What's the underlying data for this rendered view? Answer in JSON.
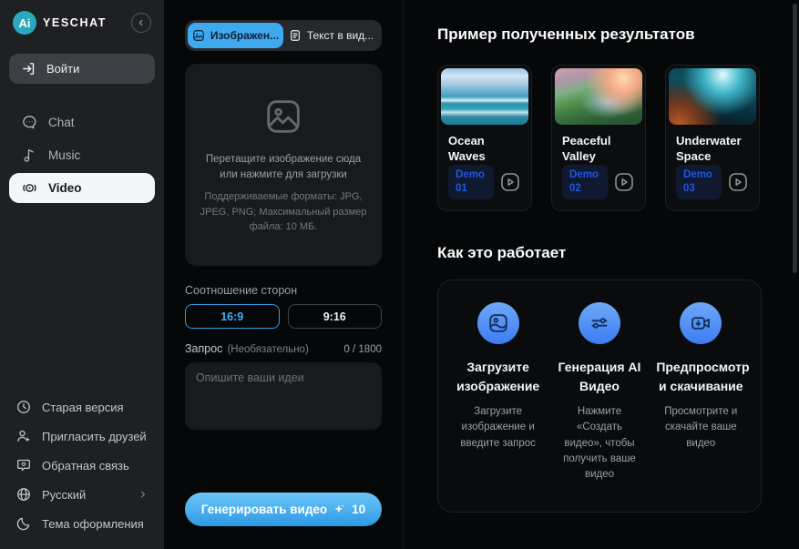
{
  "brand": {
    "name": "YESCHAT",
    "logo_text": "Ai"
  },
  "sidebar": {
    "login_label": "Войти",
    "nav": [
      {
        "label": "Chat",
        "icon": "chat-bubble-icon"
      },
      {
        "label": "Music",
        "icon": "music-note-icon"
      },
      {
        "label": "Video",
        "icon": "video-broadcast-icon",
        "active": true
      }
    ],
    "footer": [
      {
        "label": "Старая версия",
        "icon": "clock-icon"
      },
      {
        "label": "Пригласить друзей",
        "icon": "invite-user-icon"
      },
      {
        "label": "Обратная связь",
        "icon": "feedback-heart-icon"
      },
      {
        "label": "Русский",
        "icon": "globe-icon",
        "chevron": true
      },
      {
        "label": "Тема оформления",
        "icon": "moon-icon"
      }
    ]
  },
  "generator": {
    "tabs": [
      {
        "label": "Изображен...",
        "icon": "image-icon",
        "active": true
      },
      {
        "label": "Текст в вид...",
        "icon": "text-doc-icon",
        "active": false
      }
    ],
    "upload": {
      "icon": "image-placeholder-icon",
      "line1": "Перетащите изображение сюда или нажмите для загрузки",
      "line2": "Поддерживаемые форматы: JPG, JPEG, PNG; Максимальный размер файла: 10 МБ."
    },
    "aspect_label": "Соотношение сторон",
    "aspect_options": [
      {
        "label": "16:9",
        "active": true
      },
      {
        "label": "9:16",
        "active": false
      }
    ],
    "prompt": {
      "label": "Запрос",
      "optional": "(Необязательно)",
      "counter": "0 / 1800",
      "placeholder": "Опишите ваши идеи",
      "value": ""
    },
    "generate": {
      "label": "Генерировать видео",
      "icon": "sparkle-icon",
      "credits": "10"
    }
  },
  "examples": {
    "title": "Пример полученных результатов",
    "cards": [
      {
        "title": "Ocean Waves",
        "badge": "Demo 01",
        "thumbnail": "ocean-video-thumbnail"
      },
      {
        "title": "Peaceful Valley",
        "badge": "Demo 02",
        "thumbnail": "valley-video-thumbnail"
      },
      {
        "title": "Underwater Space",
        "badge": "Demo 03",
        "thumbnail": "underwater-video-thumbnail"
      }
    ]
  },
  "how": {
    "title": "Как это работает",
    "steps": [
      {
        "icon": "image-upload-icon",
        "title": "Загрузите изображение",
        "desc": "Загрузите изображение и введите запрос"
      },
      {
        "icon": "sliders-icon",
        "title": "Генерация AI Видео",
        "desc": "Нажмите «Создать видео», чтобы получить ваше видео"
      },
      {
        "icon": "video-download-icon",
        "title": "Предпросмотр и скачивание",
        "desc": "Просмотрите и скачайте ваше видео"
      }
    ]
  },
  "colors": {
    "accent_blue": "#3fa9f0",
    "badge_blue": "#2156e5",
    "logo_teal": "#2ba8bd",
    "generate_gradient_top": "#6cc6f9",
    "generate_gradient_bottom": "#2d99e5",
    "sidebar_bg": "#1e2023",
    "main_bg": "#060708"
  }
}
